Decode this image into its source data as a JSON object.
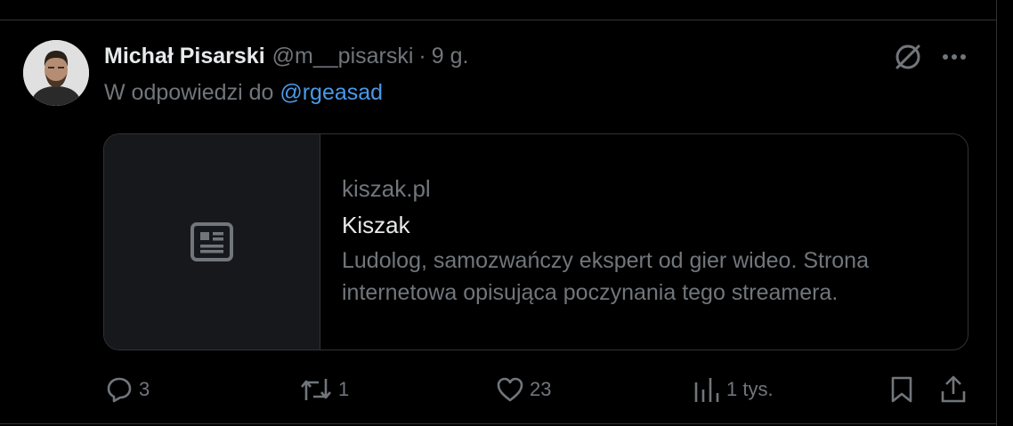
{
  "tweet": {
    "display_name": "Michał Pisarski",
    "handle": "@m__pisarski",
    "separator": "·",
    "time": "9 g.",
    "reply_prefix": "W odpowiedzi do",
    "reply_mention": "@rgeasad"
  },
  "card": {
    "domain": "kiszak.pl",
    "title": "Kiszak",
    "description": "Ludolog, samozwańczy ekspert od gier wideo. Strona internetowa opisująca poczynania tego streamera."
  },
  "actions": {
    "replies": "3",
    "reposts": "1",
    "likes": "23",
    "views": "1 tys."
  },
  "icons": {
    "header": [
      "grok-icon",
      "more-icon"
    ],
    "card": "article-icon",
    "actions": [
      "reply-icon",
      "repost-icon",
      "like-icon",
      "views-icon",
      "bookmark-icon",
      "share-icon"
    ]
  },
  "colors": {
    "background": "#000000",
    "text_primary": "#e7e9ea",
    "text_secondary": "#71767b",
    "link": "#4a99e9",
    "border": "#2f3336",
    "card_thumb_bg": "#16181c"
  }
}
